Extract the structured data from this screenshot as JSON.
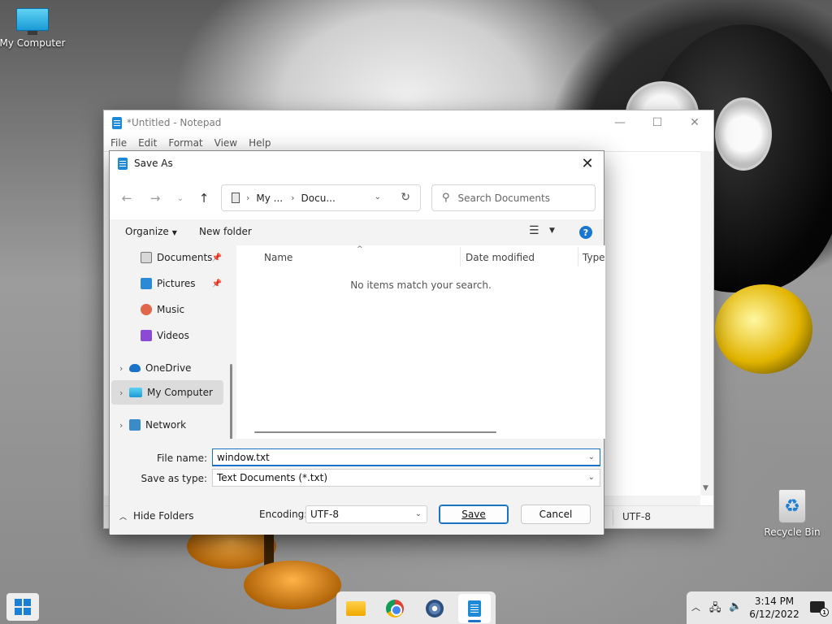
{
  "desktop": {
    "icons": [
      {
        "label": "My Computer",
        "icon": "monitor-icon"
      },
      {
        "label": "Recycle Bin",
        "icon": "recycle-bin-icon"
      }
    ]
  },
  "notepad": {
    "title": "*Untitled - Notepad",
    "menu": [
      "File",
      "Edit",
      "Format",
      "View",
      "Help"
    ],
    "status_encoding": "UTF-8"
  },
  "dialog": {
    "title": "Save As",
    "address": {
      "crumbs": [
        "My ...",
        "Docu..."
      ]
    },
    "search_placeholder": "Search Documents",
    "commands": {
      "organize": "Organize",
      "new_folder": "New folder"
    },
    "nav_items": [
      {
        "label": "Documents",
        "icon": "documents-icon",
        "pinned": true
      },
      {
        "label": "Pictures",
        "icon": "pictures-icon",
        "pinned": true
      },
      {
        "label": "Music",
        "icon": "music-icon",
        "pinned": false
      },
      {
        "label": "Videos",
        "icon": "videos-icon",
        "pinned": false
      },
      {
        "label": "OneDrive",
        "icon": "onedrive-icon",
        "pinned": false
      },
      {
        "label": "My Computer",
        "icon": "computer-icon",
        "pinned": false,
        "selected": true
      },
      {
        "label": "Network",
        "icon": "network-icon",
        "pinned": false
      }
    ],
    "columns": [
      "Name",
      "Date modified",
      "Type"
    ],
    "empty_message": "No items match your search.",
    "file_name_label": "File name:",
    "file_name_value": "window.txt",
    "save_as_type_label": "Save as type:",
    "save_as_type_value": "Text Documents (*.txt)",
    "hide_folders": "Hide Folders",
    "encoding_label": "Encoding:",
    "encoding_value": "UTF-8",
    "save_button": "Save",
    "cancel_button": "Cancel"
  },
  "taskbar": {
    "apps": [
      "file-explorer-icon",
      "chrome-icon",
      "settings-icon",
      "notepad-icon"
    ],
    "active_app": "notepad-icon",
    "clock_time": "3:14 PM",
    "clock_date": "6/12/2022"
  },
  "colors": {
    "accent": "#1a73c7",
    "help_badge": "#1976d2"
  }
}
